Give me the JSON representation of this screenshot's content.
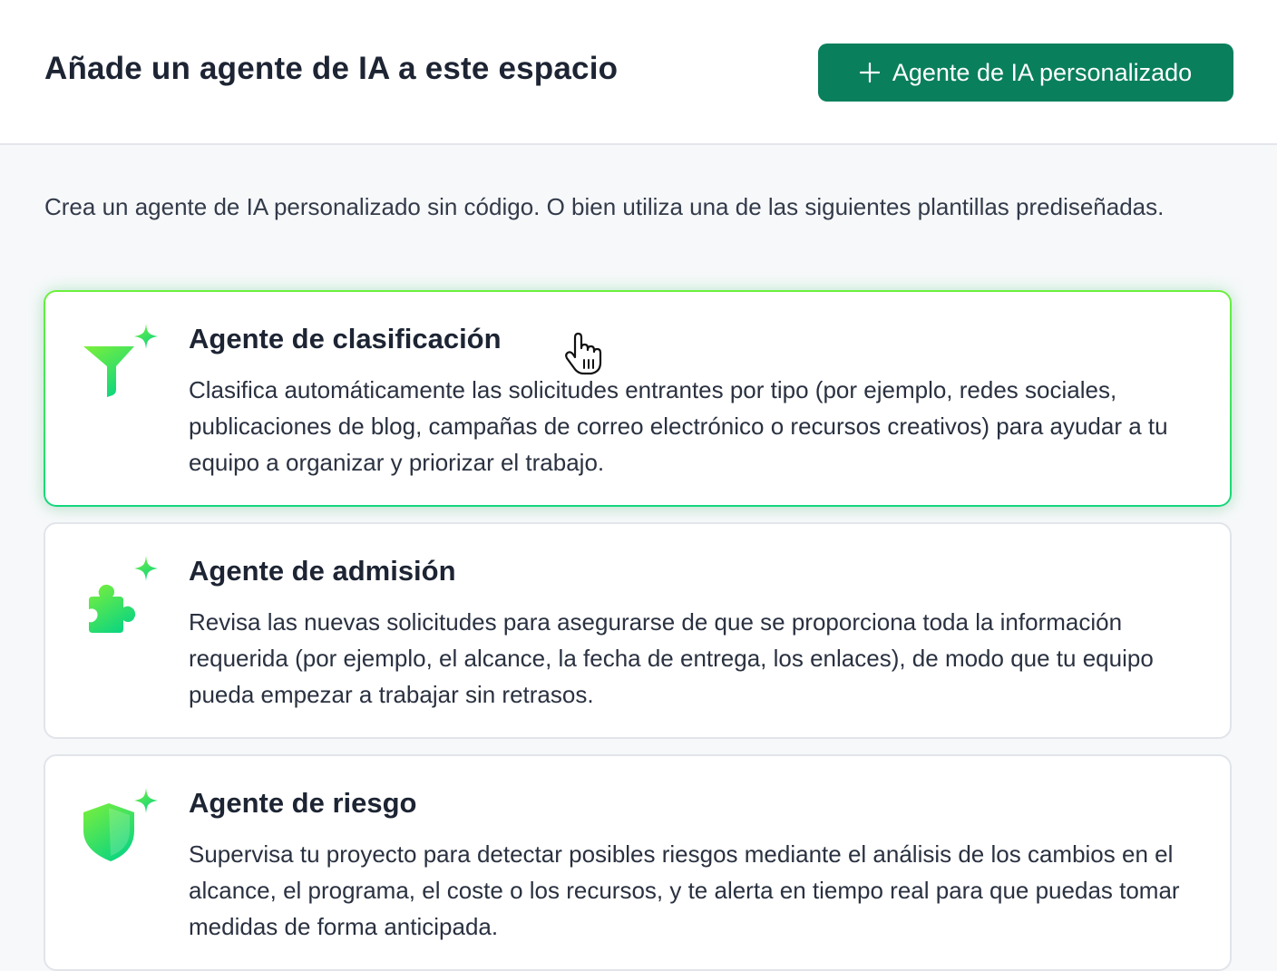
{
  "header": {
    "title": "Añade un agente de IA a este espacio",
    "custom_agent_button": "Agente de IA personalizado"
  },
  "intro": "Crea un agente de IA personalizado sin código. O bien utiliza una de las siguientes plantillas prediseñadas.",
  "agents": [
    {
      "icon": "funnel-sparkle-icon",
      "title": "Agente de clasificación",
      "description": "Clasifica automáticamente las solicitudes entrantes por tipo (por ejemplo, redes sociales, publicaciones de blog, campañas de correo electrónico o recursos creativos) para ayudar a tu equipo a organizar y priorizar el trabajo."
    },
    {
      "icon": "puzzle-sparkle-icon",
      "title": "Agente de admisión",
      "description": "Revisa las nuevas solicitudes para asegurarse de que se proporciona toda la información requerida (por ejemplo, el alcance, la fecha de entrega, los enlaces), de modo que tu equipo pueda empezar a trabajar sin retrasos."
    },
    {
      "icon": "shield-sparkle-icon",
      "title": "Agente de riesgo",
      "description": "Supervisa tu proyecto para detectar posibles riesgos mediante el análisis de los cambios en el alcance, el programa, el coste o los recursos, y te alerta en tiempo real para que puedas tomar medidas de forma anticipada."
    }
  ],
  "colors": {
    "primary_button": "#0a7f5c",
    "icon_gradient_start": "#7cf03a",
    "icon_gradient_end": "#0fd67e",
    "active_border": "#14d77c"
  }
}
